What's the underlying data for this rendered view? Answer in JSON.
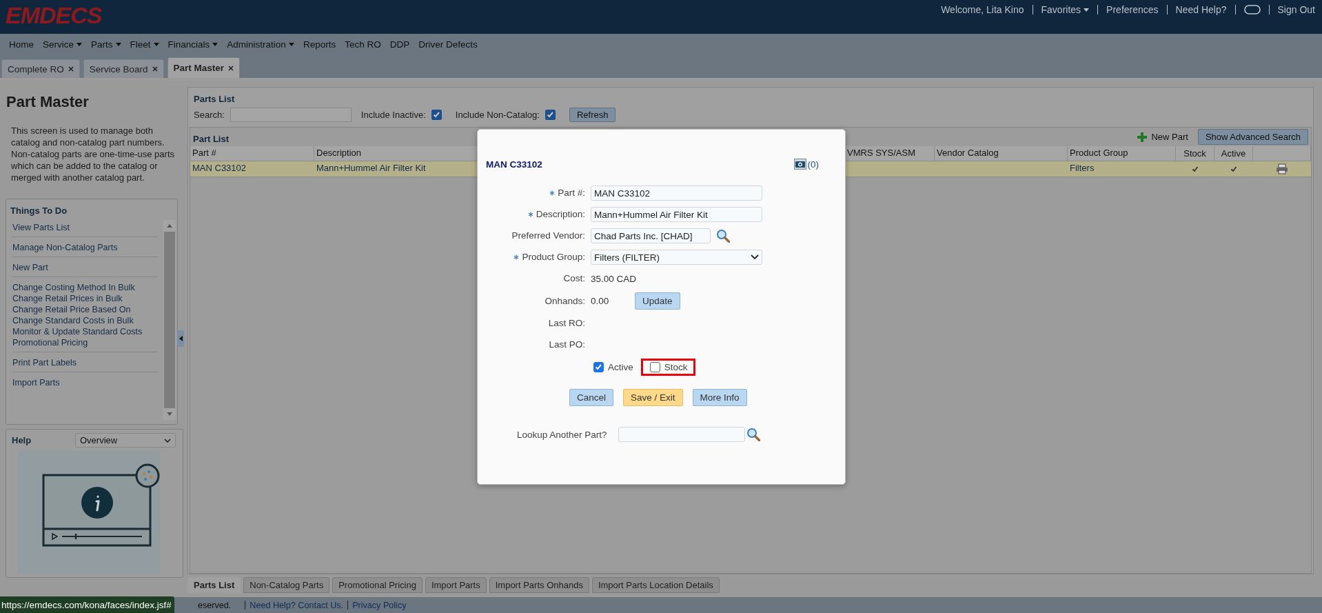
{
  "header": {
    "logo": "EMDECS",
    "links": [
      {
        "kind": "text",
        "label": "Welcome, Lita Kino"
      },
      {
        "kind": "dropdown",
        "label": "Favorites"
      },
      {
        "kind": "link",
        "label": "Preferences"
      },
      {
        "kind": "link",
        "label": "Need Help?"
      },
      {
        "kind": "toggle"
      },
      {
        "kind": "link",
        "label": "Sign Out"
      }
    ]
  },
  "menu": [
    {
      "label": "Home",
      "dropdown": false
    },
    {
      "label": "Service",
      "dropdown": true
    },
    {
      "label": "Parts",
      "dropdown": true
    },
    {
      "label": "Fleet",
      "dropdown": true
    },
    {
      "label": "Financials",
      "dropdown": true
    },
    {
      "label": "Administration",
      "dropdown": true
    },
    {
      "label": "Reports",
      "dropdown": false
    },
    {
      "label": "Tech RO",
      "dropdown": false
    },
    {
      "label": "DDP",
      "dropdown": false
    },
    {
      "label": "Driver Defects",
      "dropdown": false
    }
  ],
  "tabs": [
    {
      "label": "Complete RO",
      "selected": false
    },
    {
      "label": "Service Board",
      "selected": false
    },
    {
      "label": "Part Master",
      "selected": true
    }
  ],
  "sidebar": {
    "title": "Part Master",
    "description": "This screen is used to manage both catalog and non-catalog part numbers. Non-catalog parts are one-time-use parts which can be added to the catalog or merged with another catalog part.",
    "things_to_do": {
      "title": "Things To Do",
      "groups": [
        [
          "View Parts List"
        ],
        [
          "Manage Non-Catalog Parts"
        ],
        [
          "New Part"
        ],
        [
          "Change Costing Method In Bulk",
          "Change Retail Prices in Bulk",
          "Change Retail Price Based On",
          "Change Standard Costs in Bulk",
          "Monitor & Update Standard Costs",
          "Promotional Pricing"
        ],
        [
          "Print Part Labels"
        ],
        [
          "Import Parts"
        ]
      ]
    },
    "help": {
      "title": "Help",
      "topic": "Overview"
    }
  },
  "parts_list": {
    "title": "Parts List",
    "search_label": "Search:",
    "filters": [
      {
        "label": "Include Inactive:",
        "checked": true
      },
      {
        "label": "Include Non-Catalog:",
        "checked": true
      }
    ],
    "refresh": "Refresh"
  },
  "part_list": {
    "title": "Part List",
    "new_part": "New Part",
    "advanced_search": "Show Advanced Search",
    "columns": [
      {
        "label": "Part #",
        "kind": "text"
      },
      {
        "label": "Description",
        "kind": "text"
      },
      {
        "label": "VMRS SYS/ASM",
        "kind": "text"
      },
      {
        "label": "Vendor Catalog",
        "kind": "text"
      },
      {
        "label": "Product Group",
        "kind": "text"
      },
      {
        "label": "Stock",
        "kind": "check"
      },
      {
        "label": "Active",
        "kind": "check"
      },
      {
        "kind": "print"
      }
    ],
    "rows": [
      {
        "selected": true,
        "part": "MAN C33102",
        "description": "Mann+Hummel Air Filter Kit",
        "product_group": "Filters",
        "stock": true,
        "active": true
      }
    ]
  },
  "dialog": {
    "title": "MAN C33102",
    "photo_count": "(0)",
    "fields": [
      {
        "kind": "input",
        "label": "Part #:",
        "required": true,
        "value": "MAN C33102"
      },
      {
        "kind": "input",
        "label": "Description:",
        "required": true,
        "value": "Mann+Hummel Air Filter Kit"
      },
      {
        "kind": "lookup",
        "label": "Preferred Vendor:",
        "required": false,
        "value": "Chad Parts Inc. [CHAD]"
      },
      {
        "kind": "select",
        "label": "Product Group:",
        "required": true,
        "value": "Filters (FILTER)"
      },
      {
        "kind": "text",
        "label": "Cost:",
        "required": false,
        "value": "35.00 CAD"
      },
      {
        "kind": "text_button",
        "label": "Onhands:",
        "required": false,
        "value": "0.00",
        "button": "Update"
      },
      {
        "kind": "text",
        "label": "Last RO:",
        "required": false
      },
      {
        "kind": "text",
        "label": "Last PO:",
        "required": false
      }
    ],
    "checkboxes": [
      {
        "label": "Active",
        "checked": true,
        "highlighted": false
      },
      {
        "label": "Stock",
        "checked": false,
        "highlighted": true
      }
    ],
    "buttons": [
      {
        "label": "Cancel",
        "primary": false
      },
      {
        "label": "Save / Exit",
        "primary": true
      },
      {
        "label": "More Info",
        "primary": false
      }
    ],
    "lookup_label": "Lookup Another Part?"
  },
  "bottom_tabs": [
    {
      "label": "Parts List",
      "selected": true
    },
    {
      "label": "Non-Catalog Parts",
      "selected": false
    },
    {
      "label": "Promotional Pricing",
      "selected": false
    },
    {
      "label": "Import Parts",
      "selected": false
    },
    {
      "label": "Import Parts Onhands",
      "selected": false
    },
    {
      "label": "Import Parts Location Details",
      "selected": false
    }
  ],
  "footer": {
    "text": "eserved.",
    "links": [
      "Need Help? Contact Us.",
      "Privacy Policy"
    ]
  },
  "status_url": "https://emdecs.com/kona/faces/index.jsf#"
}
